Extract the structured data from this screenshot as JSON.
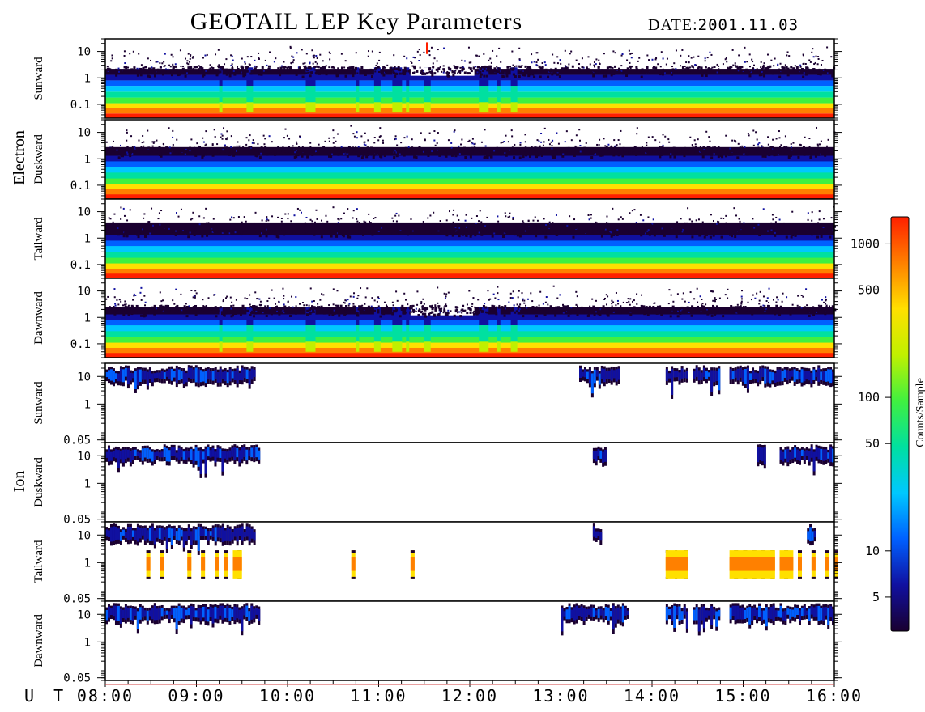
{
  "title": "GEOTAIL LEP Key Parameters",
  "date_label": "DATE:",
  "date_value": "2001.11.03",
  "ut_label": "U T",
  "species": [
    {
      "name": "Electron",
      "panels": [
        "Sunward",
        "Duskward",
        "Tailward",
        "Dawnward"
      ]
    },
    {
      "name": "Ion",
      "panels": [
        "Sunward",
        "Duskward",
        "Tailward",
        "Dawnward"
      ]
    }
  ],
  "colorbar": {
    "label": "Counts/Sample",
    "ticks": [
      "1000",
      "500",
      "100",
      "50",
      "10",
      "5"
    ],
    "tick_values": [
      1000,
      500,
      100,
      50,
      10,
      5
    ],
    "range": [
      3,
      1500
    ],
    "colors": [
      "#1a0030",
      "#1010a0",
      "#0060ff",
      "#00c8ff",
      "#00e0a0",
      "#40f040",
      "#c0f000",
      "#ffe000",
      "#ff8000",
      "#ff2000"
    ]
  },
  "chart_data": {
    "type": "heatmap",
    "title": "GEOTAIL LEP Key Parameters",
    "date": "2001.11.03",
    "x_ticks": [
      "08:00",
      "09:00",
      "10:00",
      "11:00",
      "12:00",
      "13:00",
      "14:00",
      "15:00",
      "16:00"
    ],
    "x_range_hours": [
      8,
      16
    ],
    "electron_y_ticks": [
      "10",
      "1",
      "0.1"
    ],
    "electron_ylim": [
      0.03,
      30
    ],
    "ion_y_ticks": [
      "10",
      "1",
      "0.05"
    ],
    "ion_ylim": [
      0.04,
      30
    ],
    "electron_disturbances_hours": [
      9.25,
      9.55,
      10.2,
      10.75,
      10.95,
      11.15,
      11.3,
      11.5,
      12.1,
      12.3,
      12.45
    ],
    "ion_activity_hours": [
      [
        [
          8.0,
          9.65
        ],
        [
          13.2,
          13.65
        ],
        [
          14.15,
          14.4
        ],
        [
          14.45,
          14.75
        ],
        [
          14.85,
          15.5
        ],
        [
          15.5,
          16.0
        ]
      ],
      [
        [
          8.0,
          9.7
        ],
        [
          13.35,
          13.5
        ],
        [
          15.15,
          15.25
        ],
        [
          15.4,
          16.0
        ]
      ],
      [
        [
          8.0,
          9.65
        ],
        [
          13.35,
          13.45
        ],
        [
          15.7,
          15.8
        ]
      ],
      [
        [
          8.0,
          9.7
        ],
        [
          13.0,
          13.75
        ],
        [
          14.15,
          14.4
        ],
        [
          14.45,
          14.75
        ],
        [
          14.85,
          15.4
        ],
        [
          15.4,
          16.0
        ]
      ]
    ],
    "ion_tailward_low_energy_bursts_hours": [
      8.45,
      8.6,
      8.9,
      9.05,
      9.2,
      9.3,
      9.45,
      10.7,
      11.35,
      14.15,
      14.25,
      14.35,
      14.9,
      15.0,
      15.1,
      15.2,
      15.3,
      15.45,
      15.6,
      15.75,
      15.9,
      16.0
    ]
  }
}
